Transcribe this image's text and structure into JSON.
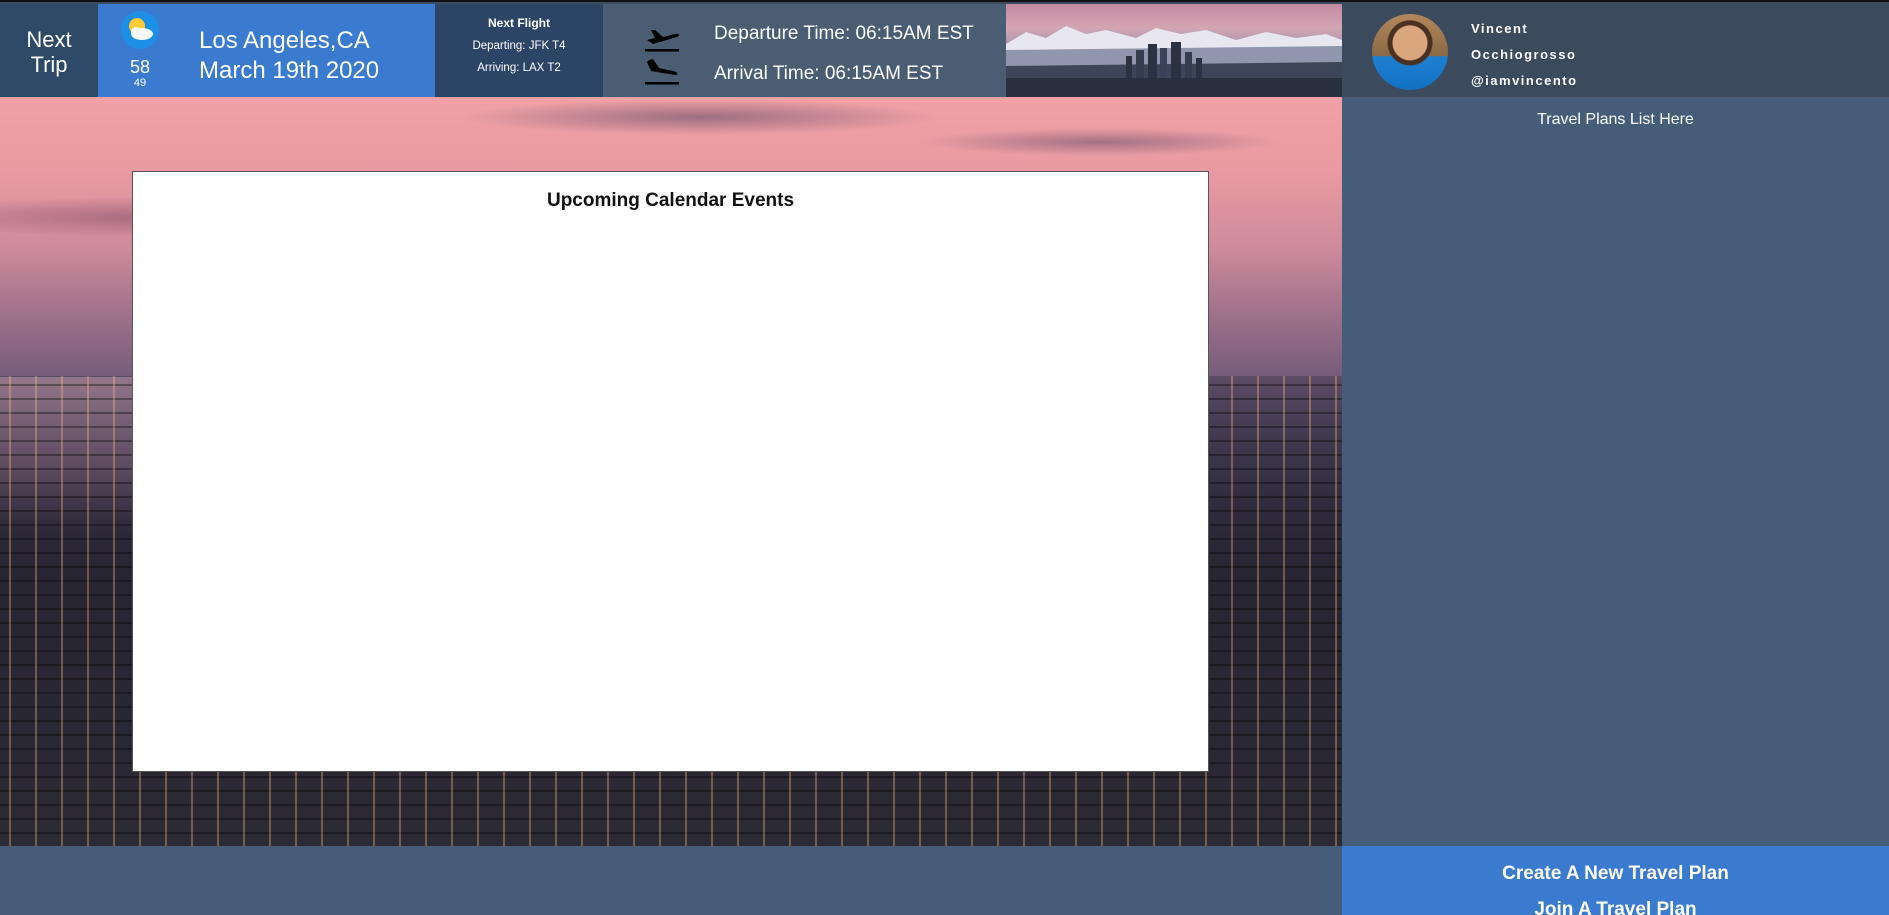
{
  "header": {
    "next_trip": {
      "line1": "Next",
      "line2": "Trip"
    },
    "weather": {
      "icon": "partly-cloudy-icon",
      "high": "58",
      "low": "49"
    },
    "destination": {
      "city": "Los Angeles,CA",
      "date": "March 19th 2020"
    },
    "flight": {
      "title": "Next Flight",
      "departing": "Departing: JFK T4",
      "arriving": "Arriving: LAX T2"
    },
    "times": {
      "departure": "Departure Time: 06:15AM EST",
      "arrival": "Arrival Time: 06:15AM EST"
    },
    "profile": {
      "first_name": "Vincent",
      "last_name": "Occhiogrosso",
      "handle": "@iamvincento"
    }
  },
  "main": {
    "calendar_title": "Upcoming Calendar Events"
  },
  "sidebar": {
    "plans_placeholder": "Travel Plans List Here",
    "create_label": "Create A New Travel Plan",
    "join_label": "Join A Travel Plan"
  },
  "colors": {
    "accent_blue": "#3a7bcf",
    "panel_slate": "#465d7a",
    "header_dark": "#3b4a5c"
  }
}
